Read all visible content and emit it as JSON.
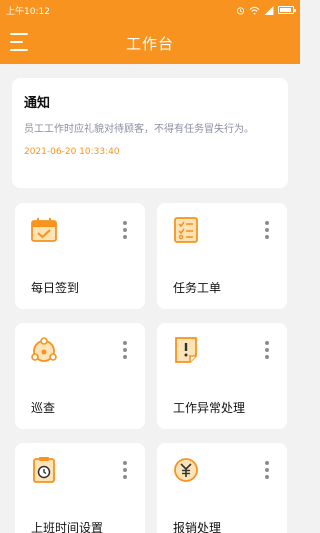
{
  "status_bar": {
    "time": "上午10:12",
    "battery": "■"
  },
  "header": {
    "title": "工作台"
  },
  "notice": {
    "title": "通知",
    "body": "员工工作时应礼貌对待顾客，不得有任务冒失行为。",
    "time": "2021-06-20 10:33:40"
  },
  "cards": [
    {
      "label": "每日签到",
      "icon": "calendar-check-icon"
    },
    {
      "label": "任务工单",
      "icon": "task-list-icon"
    },
    {
      "label": "巡查",
      "icon": "patrol-location-icon"
    },
    {
      "label": "工作异常处理",
      "icon": "exception-alert-icon"
    },
    {
      "label": "上班时间设置",
      "icon": "work-time-icon"
    },
    {
      "label": "报销处理",
      "icon": "reimbursement-icon"
    }
  ],
  "colors": {
    "accent": "#f7931e",
    "icon_fill": "#fde3b8",
    "background": "#f2f2f2"
  }
}
